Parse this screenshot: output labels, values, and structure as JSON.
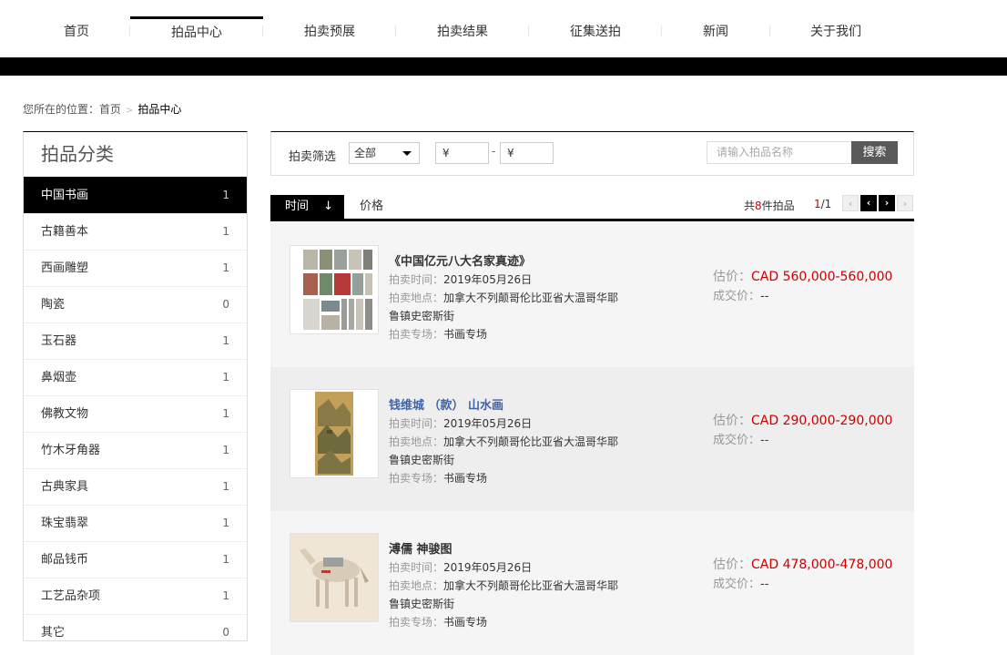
{
  "nav": {
    "items": [
      "首页",
      "拍品中心",
      "拍卖预展",
      "拍卖结果",
      "征集送拍",
      "新闻",
      "关于我们"
    ],
    "active_index": 1
  },
  "breadcrumb": {
    "prefix": "您所在的位置：",
    "home": "首页",
    "separator": ">",
    "current": "拍品中心"
  },
  "sidebar": {
    "title": "拍品分类",
    "categories": [
      {
        "label": "中国书画",
        "count": "1"
      },
      {
        "label": "古籍善本",
        "count": "1"
      },
      {
        "label": "西画雕塑",
        "count": "1"
      },
      {
        "label": "陶瓷",
        "count": "0"
      },
      {
        "label": "玉石器",
        "count": "1"
      },
      {
        "label": "鼻烟壶",
        "count": "1"
      },
      {
        "label": "佛教文物",
        "count": "1"
      },
      {
        "label": "竹木牙角器",
        "count": "1"
      },
      {
        "label": "古典家具",
        "count": "1"
      },
      {
        "label": "珠宝翡翠",
        "count": "1"
      },
      {
        "label": "邮品钱币",
        "count": "1"
      },
      {
        "label": "工艺品杂项",
        "count": "1"
      },
      {
        "label": "其它",
        "count": "0"
      }
    ],
    "active_index": 0
  },
  "filter": {
    "label": "拍卖筛选",
    "select_value": "全部",
    "price_min": "¥",
    "price_dash": "-",
    "price_max": "¥",
    "search_placeholder": "请输入拍品名称",
    "search_button": "搜索"
  },
  "sort": {
    "time_label": "时间",
    "time_arrow": "↓",
    "price_label": "价格",
    "total_prefix": "共",
    "total_count": "8",
    "total_suffix": "件拍品",
    "page_current": "1",
    "page_total": "/1",
    "prev_first": "‹",
    "prev": "‹",
    "next": "›",
    "next_last": "›"
  },
  "items": [
    {
      "title": "《中国亿元八大名家真迹》",
      "time_label": "拍卖时间：",
      "time": "2019年05月26日",
      "place_label": "拍卖地点：",
      "place": "加拿大不列颠哥伦比亚省大温哥华耶鲁镇史密斯街",
      "session_label": "拍卖专场：",
      "session": "书画专场",
      "estimate_label": "估价：",
      "estimate": "CAD 560,000-560,000",
      "deal_label": "成交价：",
      "deal": "--"
    },
    {
      "title": "钱维城 （款） 山水画",
      "time_label": "拍卖时间：",
      "time": "2019年05月26日",
      "place_label": "拍卖地点：",
      "place": "加拿大不列颠哥伦比亚省大温哥华耶鲁镇史密斯街",
      "session_label": "拍卖专场：",
      "session": "书画专场",
      "estimate_label": "估价：",
      "estimate": "CAD 290,000-290,000",
      "deal_label": "成交价：",
      "deal": "--"
    },
    {
      "title": "溥儒 神骏图",
      "time_label": "拍卖时间：",
      "time": "2019年05月26日",
      "place_label": "拍卖地点：",
      "place": "加拿大不列颠哥伦比亚省大温哥华耶鲁镇史密斯街",
      "session_label": "拍卖专场：",
      "session": "书画专场",
      "estimate_label": "估价：",
      "estimate": "CAD 478,000-478,000",
      "deal_label": "成交价：",
      "deal": "--"
    }
  ],
  "colors": {
    "accent": "#cc0000",
    "link": "#3f63a7",
    "bar": "#000000"
  }
}
